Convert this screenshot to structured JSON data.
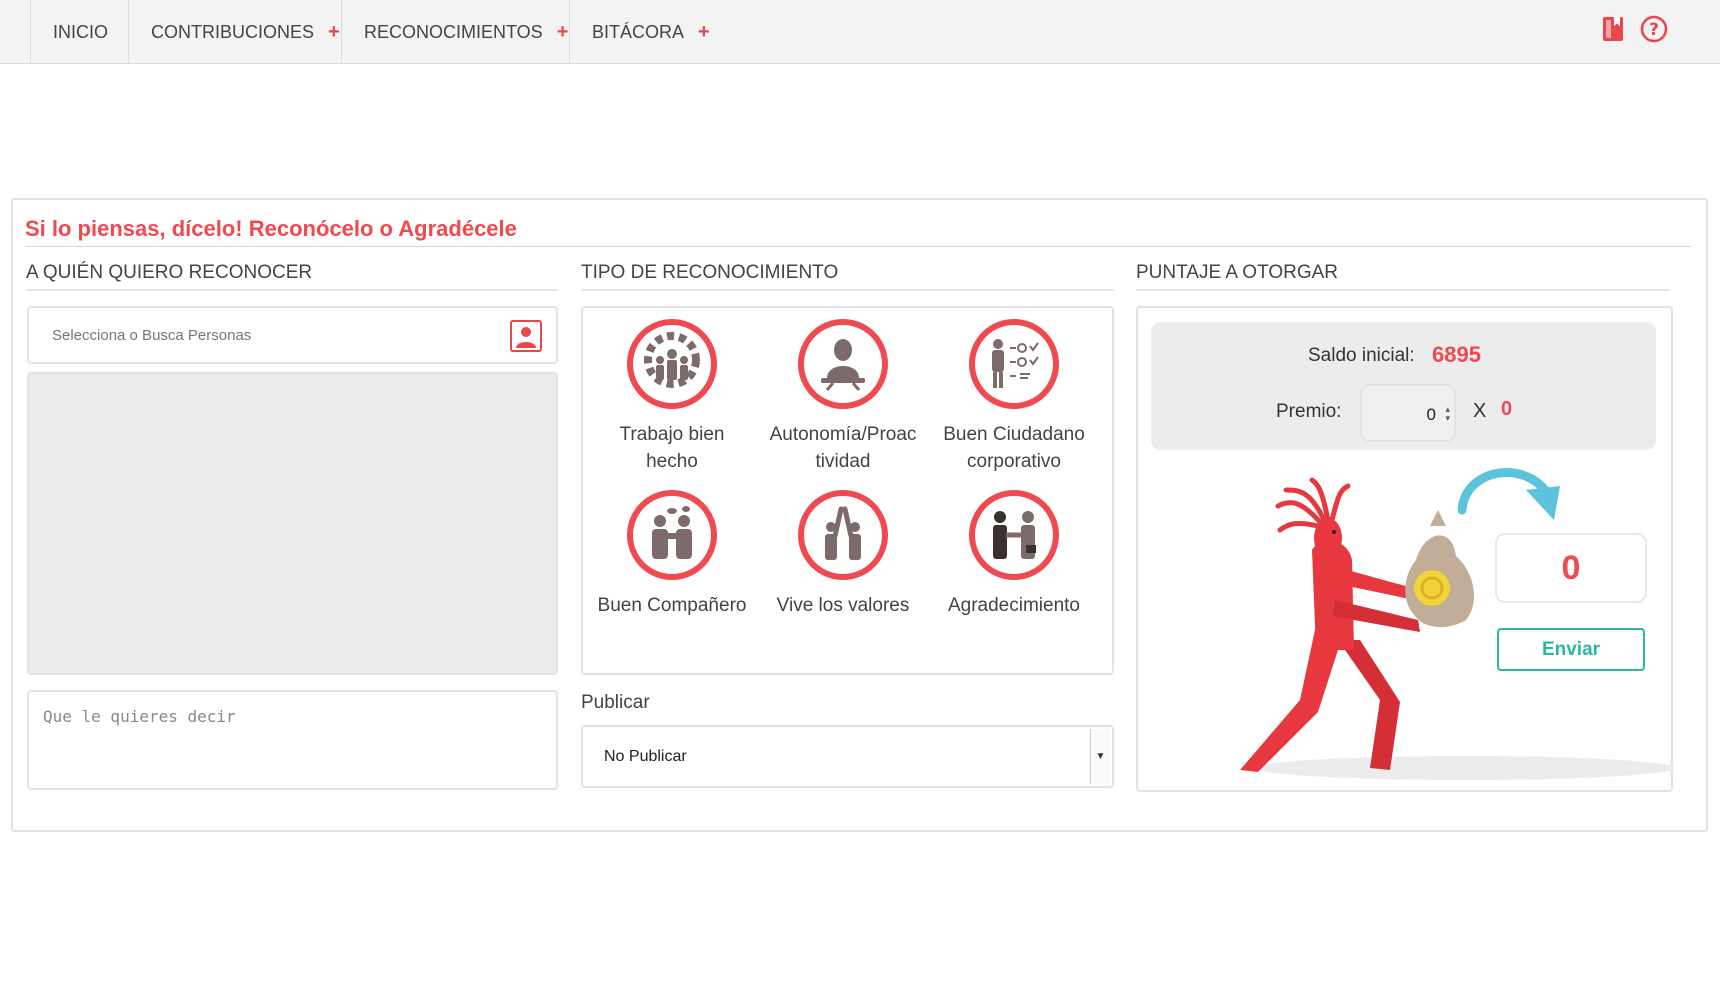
{
  "nav": {
    "items": [
      {
        "label": "INICIO"
      },
      {
        "label": "CONTRIBUCIONES",
        "plus": "+"
      },
      {
        "label": "RECONOCIMIENTOS",
        "plus": "+"
      },
      {
        "label": "BITÁCORA",
        "plus": "+"
      }
    ],
    "icons": [
      "bookmark-icon",
      "help-icon"
    ]
  },
  "panel": {
    "title": "Si lo piensas, dícelo! Reconócelo o Agradécele"
  },
  "left": {
    "heading": "A QUIÉN QUIERO RECONOCER",
    "search_placeholder": "Selecciona o Busca Personas",
    "message_placeholder": "Que le quieres decir"
  },
  "middle": {
    "heading": "TIPO DE RECONOCIMIENTO",
    "types": [
      {
        "label": "Trabajo bien hecho",
        "icon": "gear-team-icon"
      },
      {
        "label": "Autonomía/Proactividad",
        "icon": "person-desk-icon"
      },
      {
        "label": "Buen Ciudadano corporativo",
        "icon": "person-checklist-icon"
      },
      {
        "label": "Buen Compañero",
        "icon": "group-chat-icon"
      },
      {
        "label": "Vive los valores",
        "icon": "high-five-icon"
      },
      {
        "label": "Agradecimiento",
        "icon": "handshake-icon"
      }
    ],
    "publish_label": "Publicar",
    "publish_value": "No Publicar"
  },
  "right": {
    "heading": "PUNTAJE A OTORGAR",
    "saldo_label": "Saldo inicial:",
    "saldo_value": "6895",
    "premio_label": "Premio:",
    "premio_value": "0",
    "multiplier_label": "X",
    "multiplier_value": "0",
    "total": "0",
    "send_label": "Enviar"
  },
  "colors": {
    "accent": "#ef4a50",
    "teal": "#2cb6a0",
    "arrow": "#5bc4dc",
    "icon_fill": "#7d6a6a"
  }
}
